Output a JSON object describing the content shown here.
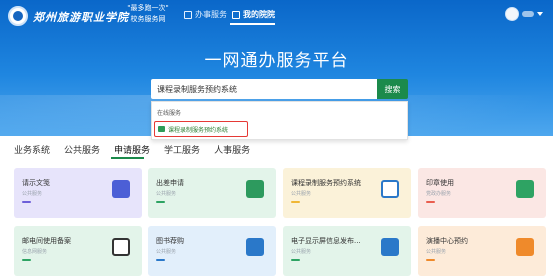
{
  "header": {
    "school_name": "郑州旅游职业学院",
    "slogan_line1": "\"最多跑一次\"",
    "slogan_line2": "校务服务网",
    "nav": [
      {
        "label": "办事服务",
        "icon": "desk-icon"
      },
      {
        "label": "我的院院",
        "icon": "building-icon"
      }
    ]
  },
  "hero": {
    "title": "一网通办服务平台",
    "search_value": "课程录制服务预约系统",
    "search_button": "搜索"
  },
  "dropdown": {
    "header": "在线服务",
    "result": "课程录制服务预约系统"
  },
  "tabs": [
    "业务系统",
    "公共服务",
    "申请服务",
    "学工服务",
    "人事服务"
  ],
  "active_tab": "申请服务",
  "cards": [
    {
      "title": "请示文笺",
      "sub": "公共服务",
      "icon": "document-icon"
    },
    {
      "title": "出差申请",
      "sub": "公共服务",
      "icon": "airplane-icon"
    },
    {
      "title": "课程录制服务预约系统",
      "sub": "公共服务",
      "icon": "screen-icon"
    },
    {
      "title": "印章使用",
      "sub": "党政办服务",
      "icon": "stamp-icon"
    },
    {
      "title": "邮电间使用备案",
      "sub": "信息网服务",
      "icon": "monitor-icon"
    },
    {
      "title": "图书荐购",
      "sub": "公共服务",
      "icon": "printer-icon"
    },
    {
      "title": "电子显示屏信息发布...",
      "sub": "公共服务",
      "icon": "led-icon"
    },
    {
      "title": "演播中心预约",
      "sub": "公共服务",
      "icon": "printer-icon"
    }
  ],
  "colors": {
    "hero_blue": "#1f86e0",
    "accent_green": "#1b8a4b",
    "highlight_red": "#e53935"
  }
}
